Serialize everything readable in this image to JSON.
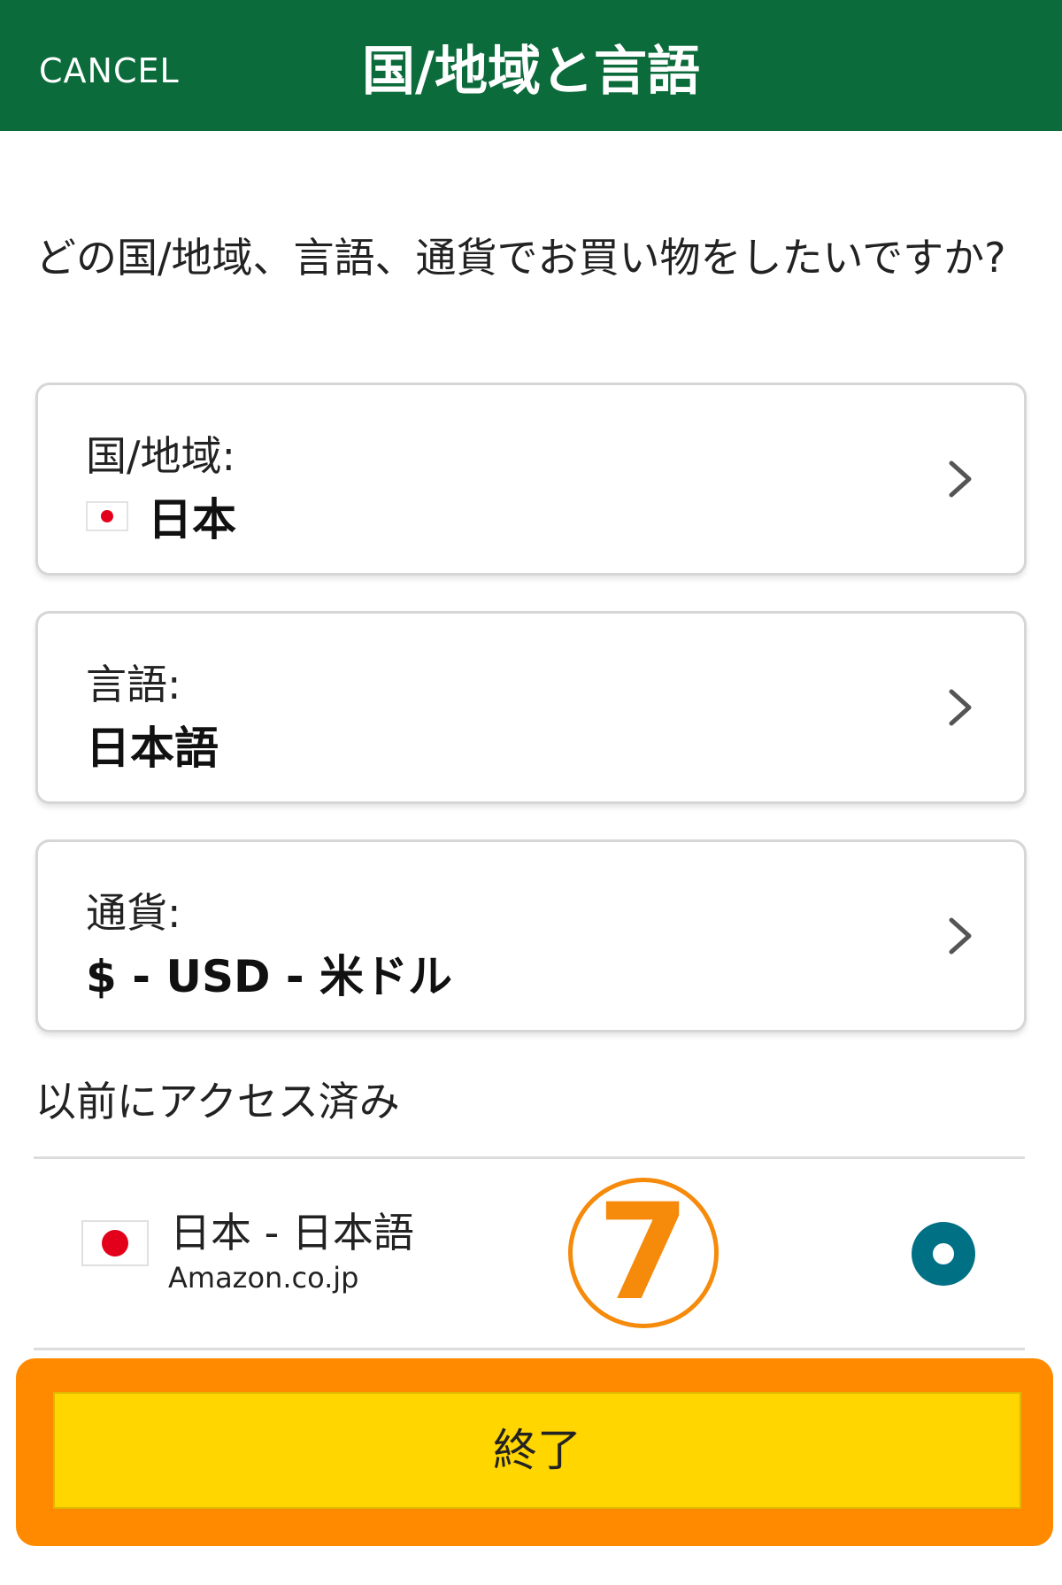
{
  "header": {
    "cancel_label": "CANCEL",
    "title": "国/地域と言語",
    "background_color": "#0b6b3b"
  },
  "question": "どの国/地域、言語、通貨でお買い物をしたいですか?",
  "settings": [
    {
      "label": "国/地域:",
      "value": "日本",
      "icon": "japan-flag-icon"
    },
    {
      "label": "言語:",
      "value": "日本語"
    },
    {
      "label": "通貨:",
      "value": "$ - USD - 米ドル"
    }
  ],
  "previously_accessed": {
    "heading": "以前にアクセス済み",
    "items": [
      {
        "name": "日本 - 日本語",
        "site": "Amazon.co.jp",
        "selected": true,
        "icon": "japan-flag-icon"
      }
    ]
  },
  "annotation": {
    "step_number": "7",
    "color": "#f58a0b"
  },
  "done_button": {
    "label": "終了",
    "color": "#ffd600"
  },
  "radio_color": "#007185"
}
